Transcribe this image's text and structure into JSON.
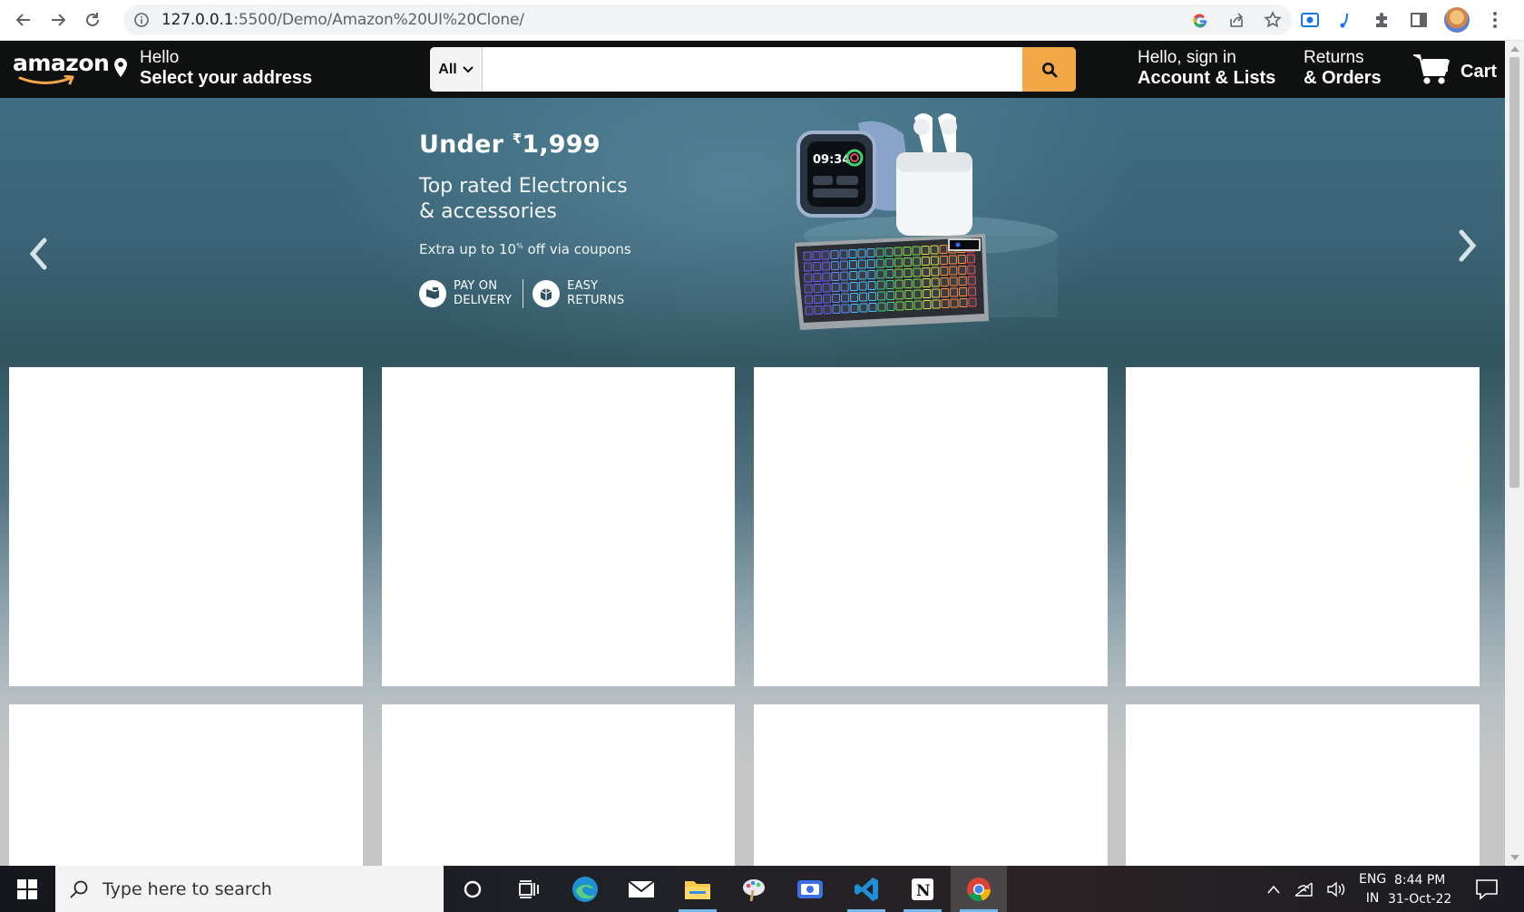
{
  "browser": {
    "url_host": "127.0.0.1",
    "url_rest": ":5500/Demo/Amazon%20UI%20Clone/"
  },
  "navbar": {
    "logo": "amazon",
    "address_line1": "Hello",
    "address_line2": "Select your address",
    "search_category": "All",
    "search_placeholder": "",
    "account_line1": "Hello, sign in",
    "account_line2": "Account & Lists",
    "returns_line1": "Returns",
    "returns_line2": "& Orders",
    "cart_label": "Cart"
  },
  "hero": {
    "headline_prefix": "Under",
    "currency": "₹",
    "price": "1,999",
    "subheadline_1": "Top rated Electronics",
    "subheadline_2": "& accessories",
    "offer_1": "Extra up to 10",
    "offer_pct": "%",
    "offer_2": " off via coupons",
    "badge1_line1": "PAY ON",
    "badge1_line2": "DELIVERY",
    "badge2_line1": "EASY",
    "badge2_line2": "RETURNS",
    "watch_time": "09:34"
  },
  "taskbar": {
    "search_placeholder": "Type here to search",
    "lang_1": "ENG",
    "lang_2": "IN",
    "time": "8:44 PM",
    "date": "31-Oct-22"
  }
}
